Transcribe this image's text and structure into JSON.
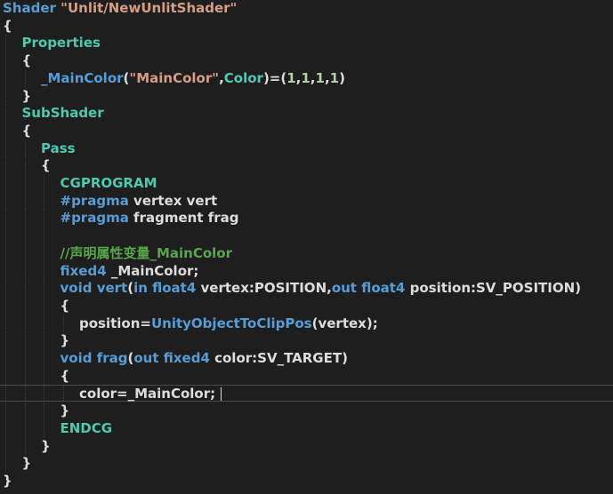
{
  "editor": {
    "lines": [
      {
        "indent": 0,
        "tokens": [
          {
            "c": "kw",
            "t": "Shader "
          },
          {
            "c": "str",
            "t": "\"Unlit/NewUnlitShader\""
          }
        ]
      },
      {
        "indent": 0,
        "tokens": [
          {
            "c": "plain",
            "t": "{"
          }
        ]
      },
      {
        "indent": 1,
        "tokens": [
          {
            "c": "cls",
            "t": "Properties"
          }
        ]
      },
      {
        "indent": 1,
        "tokens": [
          {
            "c": "plain",
            "t": "{"
          }
        ]
      },
      {
        "indent": 2,
        "tokens": [
          {
            "c": "kw",
            "t": "_MainColor"
          },
          {
            "c": "plain",
            "t": "("
          },
          {
            "c": "str",
            "t": "\"MainColor\""
          },
          {
            "c": "plain",
            "t": ","
          },
          {
            "c": "cls",
            "t": "Color"
          },
          {
            "c": "plain",
            "t": ")=("
          },
          {
            "c": "num",
            "t": "1"
          },
          {
            "c": "plain",
            "t": ","
          },
          {
            "c": "num",
            "t": "1"
          },
          {
            "c": "plain",
            "t": ","
          },
          {
            "c": "num",
            "t": "1"
          },
          {
            "c": "plain",
            "t": ","
          },
          {
            "c": "num",
            "t": "1"
          },
          {
            "c": "plain",
            "t": ")"
          }
        ]
      },
      {
        "indent": 1,
        "tokens": [
          {
            "c": "plain",
            "t": "}"
          }
        ]
      },
      {
        "indent": 1,
        "tokens": [
          {
            "c": "cls",
            "t": "SubShader"
          }
        ]
      },
      {
        "indent": 1,
        "tokens": [
          {
            "c": "plain",
            "t": "{"
          }
        ]
      },
      {
        "indent": 2,
        "tokens": [
          {
            "c": "cls",
            "t": "Pass"
          }
        ]
      },
      {
        "indent": 2,
        "tokens": [
          {
            "c": "plain",
            "t": "{"
          }
        ]
      },
      {
        "indent": 3,
        "tokens": [
          {
            "c": "cls",
            "t": "CGPROGRAM"
          }
        ]
      },
      {
        "indent": 3,
        "tokens": [
          {
            "c": "pre",
            "t": "#pragma"
          },
          {
            "c": "plain",
            "t": " vertex vert"
          }
        ]
      },
      {
        "indent": 3,
        "tokens": [
          {
            "c": "pre",
            "t": "#pragma"
          },
          {
            "c": "plain",
            "t": " fragment frag"
          }
        ]
      },
      {
        "indent": 3,
        "tokens": []
      },
      {
        "indent": 3,
        "tokens": [
          {
            "c": "cm",
            "t": "//声明属性变量_MainColor"
          }
        ]
      },
      {
        "indent": 3,
        "tokens": [
          {
            "c": "kw",
            "t": "fixed4"
          },
          {
            "c": "plain",
            "t": " _MainColor;"
          }
        ]
      },
      {
        "indent": 3,
        "tokens": [
          {
            "c": "kw",
            "t": "void "
          },
          {
            "c": "kw",
            "t": "vert"
          },
          {
            "c": "plain",
            "t": "("
          },
          {
            "c": "kw",
            "t": "in "
          },
          {
            "c": "kw",
            "t": "float4"
          },
          {
            "c": "plain",
            "t": " vertex:POSITION,"
          },
          {
            "c": "kw",
            "t": "out "
          },
          {
            "c": "kw",
            "t": "float4"
          },
          {
            "c": "plain",
            "t": " position:SV_POSITION)"
          }
        ]
      },
      {
        "indent": 3,
        "tokens": [
          {
            "c": "plain",
            "t": "{"
          }
        ]
      },
      {
        "indent": 4,
        "tokens": [
          {
            "c": "plain",
            "t": "position="
          },
          {
            "c": "kw",
            "t": "UnityObjectToClipPos"
          },
          {
            "c": "plain",
            "t": "(vertex);"
          }
        ]
      },
      {
        "indent": 3,
        "tokens": [
          {
            "c": "plain",
            "t": "}"
          }
        ]
      },
      {
        "indent": 3,
        "tokens": [
          {
            "c": "kw",
            "t": "void "
          },
          {
            "c": "kw",
            "t": "frag"
          },
          {
            "c": "plain",
            "t": "("
          },
          {
            "c": "kw",
            "t": "out "
          },
          {
            "c": "kw",
            "t": "fixed4"
          },
          {
            "c": "plain",
            "t": " color:SV_TARGET)"
          }
        ]
      },
      {
        "indent": 3,
        "tokens": [
          {
            "c": "plain",
            "t": "{"
          }
        ]
      },
      {
        "indent": 4,
        "tokens": [
          {
            "c": "plain",
            "t": "color=_MainColor;"
          }
        ],
        "current": true
      },
      {
        "indent": 3,
        "tokens": [
          {
            "c": "plain",
            "t": "}"
          }
        ]
      },
      {
        "indent": 3,
        "tokens": [
          {
            "c": "cls",
            "t": "ENDCG"
          }
        ]
      },
      {
        "indent": 2,
        "tokens": [
          {
            "c": "plain",
            "t": "}"
          }
        ]
      },
      {
        "indent": 1,
        "tokens": [
          {
            "c": "plain",
            "t": "}"
          }
        ]
      },
      {
        "indent": 0,
        "tokens": [
          {
            "c": "plain",
            "t": "}"
          }
        ]
      }
    ]
  },
  "colors": {
    "background": "#1e1e1e",
    "keyword": "#569cd6",
    "string": "#d69d85",
    "type": "#4ec9b0",
    "number": "#b5cea8",
    "comment": "#57a64a",
    "text": "#dcdcdc"
  }
}
